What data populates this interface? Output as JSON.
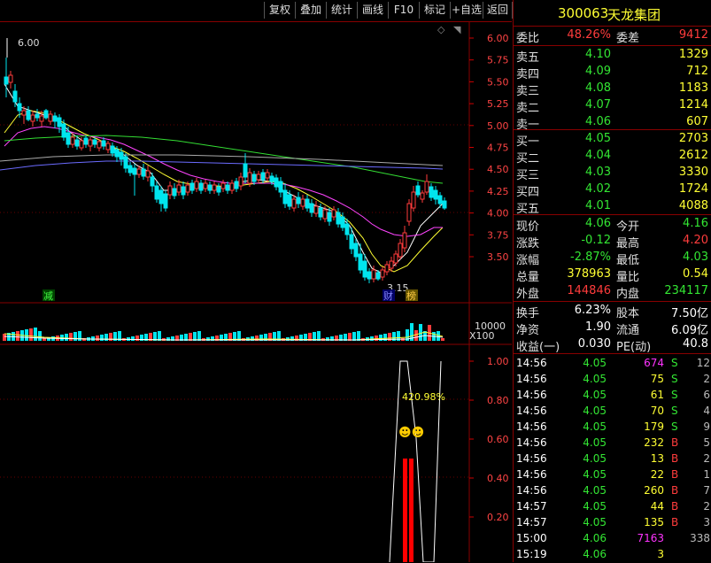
{
  "toolbar": {
    "buttons": [
      "复权",
      "叠加",
      "统计",
      "画线",
      "F10",
      "标记",
      "+自选",
      "返回"
    ],
    "diamond": "◇",
    "arrow": "◥"
  },
  "stock": {
    "code": "300063",
    "name": "天龙集团"
  },
  "chart": {
    "price_ticks": [
      "6.00",
      "5.75",
      "5.50",
      "5.25",
      "5.00",
      "4.75",
      "4.50",
      "4.25",
      "4.00",
      "3.75",
      "3.50"
    ],
    "volume_ticks": [
      "10000",
      "X100"
    ],
    "indicator_ticks": [
      "1.00",
      "0.80",
      "0.60",
      "0.40",
      "0.20"
    ],
    "high_label": "6.00",
    "low_label": "3.15",
    "mark_jian": "减",
    "mark_cai": "财",
    "mark_bang": "榜",
    "indicator_text": "420.98%",
    "smiley": "☻☻"
  },
  "order_book": {
    "weibi_label": "委比",
    "weibi_value": "48.26%",
    "weicha_label": "委差",
    "weicha_value": "9412",
    "asks": [
      {
        "label": "卖五",
        "price": "4.10",
        "vol": "1329"
      },
      {
        "label": "卖四",
        "price": "4.09",
        "vol": "712"
      },
      {
        "label": "卖三",
        "price": "4.08",
        "vol": "1183"
      },
      {
        "label": "卖二",
        "price": "4.07",
        "vol": "1214"
      },
      {
        "label": "卖一",
        "price": "4.06",
        "vol": "607"
      }
    ],
    "bids": [
      {
        "label": "买一",
        "price": "4.05",
        "vol": "2703"
      },
      {
        "label": "买二",
        "price": "4.04",
        "vol": "2612"
      },
      {
        "label": "买三",
        "price": "4.03",
        "vol": "3330"
      },
      {
        "label": "买四",
        "price": "4.02",
        "vol": "1724"
      },
      {
        "label": "买五",
        "price": "4.01",
        "vol": "4088"
      }
    ]
  },
  "quote": {
    "rows": [
      [
        {
          "l": "现价",
          "v": "4.06",
          "c": "green"
        },
        {
          "l": "今开",
          "v": "4.16",
          "c": "green"
        }
      ],
      [
        {
          "l": "涨跌",
          "v": "-0.12",
          "c": "green"
        },
        {
          "l": "最高",
          "v": "4.20",
          "c": "red"
        }
      ],
      [
        {
          "l": "涨幅",
          "v": "-2.87%",
          "c": "green"
        },
        {
          "l": "最低",
          "v": "4.03",
          "c": "green"
        }
      ],
      [
        {
          "l": "总量",
          "v": "378963",
          "c": "yellow"
        },
        {
          "l": "量比",
          "v": "0.54",
          "c": "yellow"
        }
      ],
      [
        {
          "l": "外盘",
          "v": "144846",
          "c": "red"
        },
        {
          "l": "内盘",
          "v": "234117",
          "c": "green"
        }
      ]
    ]
  },
  "fundamentals": {
    "rows": [
      [
        {
          "l": "换手",
          "v": "6.23%"
        },
        {
          "l": "股本",
          "v": "7.50亿"
        }
      ],
      [
        {
          "l": "净资",
          "v": "1.90"
        },
        {
          "l": "流通",
          "v": "6.09亿"
        }
      ],
      [
        {
          "l": "收益(一)",
          "v": "0.030"
        },
        {
          "l": "PE(动)",
          "v": "40.8"
        }
      ]
    ]
  },
  "trades": [
    {
      "t": "14:56",
      "p": "4.05",
      "v": "674",
      "s": "S",
      "n": "12",
      "vc": "magenta"
    },
    {
      "t": "14:56",
      "p": "4.05",
      "v": "75",
      "s": "S",
      "n": "2",
      "vc": "yellow"
    },
    {
      "t": "14:56",
      "p": "4.05",
      "v": "61",
      "s": "S",
      "n": "6",
      "vc": "yellow"
    },
    {
      "t": "14:56",
      "p": "4.05",
      "v": "70",
      "s": "S",
      "n": "4",
      "vc": "yellow"
    },
    {
      "t": "14:56",
      "p": "4.05",
      "v": "179",
      "s": "S",
      "n": "9",
      "vc": "yellow"
    },
    {
      "t": "14:56",
      "p": "4.05",
      "v": "232",
      "s": "B",
      "n": "5",
      "vc": "yellow"
    },
    {
      "t": "14:56",
      "p": "4.05",
      "v": "13",
      "s": "B",
      "n": "2",
      "vc": "yellow"
    },
    {
      "t": "14:56",
      "p": "4.05",
      "v": "22",
      "s": "B",
      "n": "1",
      "vc": "yellow"
    },
    {
      "t": "14:56",
      "p": "4.05",
      "v": "260",
      "s": "B",
      "n": "7",
      "vc": "yellow"
    },
    {
      "t": "14:57",
      "p": "4.05",
      "v": "44",
      "s": "B",
      "n": "2",
      "vc": "yellow"
    },
    {
      "t": "14:57",
      "p": "4.05",
      "v": "135",
      "s": "B",
      "n": "3",
      "vc": "yellow"
    },
    {
      "t": "15:00",
      "p": "4.06",
      "v": "7163",
      "s": "",
      "n": "338",
      "vc": "magenta"
    },
    {
      "t": "15:19",
      "p": "4.06",
      "v": "3",
      "s": "",
      "n": "",
      "vc": "yellow"
    }
  ]
}
